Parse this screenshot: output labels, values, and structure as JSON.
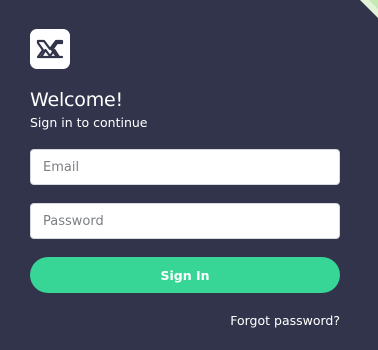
{
  "header": {
    "logo_icon": "mw-logo-icon",
    "title": "Welcome!",
    "subtitle": "Sign in to continue"
  },
  "form": {
    "email_placeholder": "Email",
    "email_value": "",
    "password_placeholder": "Password",
    "password_value": "",
    "signin_label": "Sign In",
    "forgot_label": "Forgot password?"
  },
  "colors": {
    "background": "#31344b",
    "accent": "#37d596",
    "corner_decoration": "#d8f0c8"
  }
}
